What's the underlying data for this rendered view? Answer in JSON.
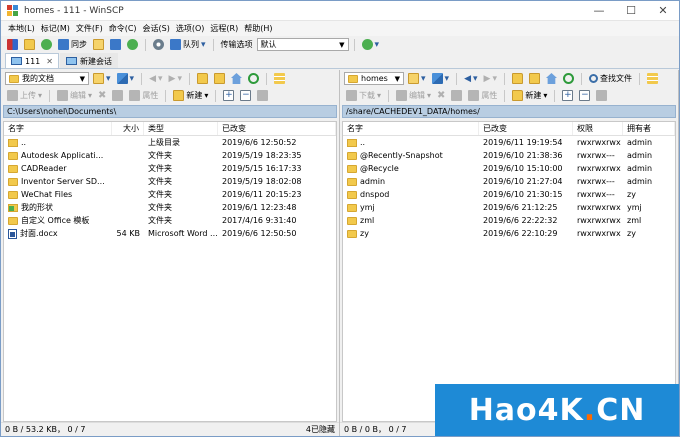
{
  "window": {
    "title": "homes - 111 - WinSCP"
  },
  "menu": [
    "本地(L)",
    "标记(M)",
    "文件(F)",
    "命令(C)",
    "会话(S)",
    "选项(O)",
    "远程(R)",
    "帮助(H)"
  ],
  "toolbar": {
    "sync_label": "同步",
    "queue_label": "队列",
    "transfer_options_label": "传输选项",
    "transfer_preset": "默认"
  },
  "tabs": [
    {
      "label": "111"
    },
    {
      "label": "新建会话"
    }
  ],
  "left": {
    "location": "我的文档",
    "upload_label": "上传",
    "edit_label": "编辑",
    "properties_label": "属性",
    "new_label": "新建",
    "path": "C:\\Users\\nohel\\Documents\\",
    "columns": [
      "名字",
      "大小",
      "类型",
      "已改变"
    ],
    "files": [
      {
        "icon": "up",
        "name": "..",
        "size": "",
        "type": "上级目录",
        "changed": "2019/6/6  12:50:52"
      },
      {
        "icon": "folder",
        "name": "Autodesk Applicati...",
        "size": "",
        "type": "文件夹",
        "changed": "2019/5/19  18:23:35"
      },
      {
        "icon": "folder",
        "name": "CADReader",
        "size": "",
        "type": "文件夹",
        "changed": "2019/5/15  16:17:33"
      },
      {
        "icon": "folder",
        "name": "Inventor Server SD...",
        "size": "",
        "type": "文件夹",
        "changed": "2019/5/19  18:02:08"
      },
      {
        "icon": "folder",
        "name": "WeChat Files",
        "size": "",
        "type": "文件夹",
        "changed": "2019/6/11  20:15:23"
      },
      {
        "icon": "special",
        "name": "我的形状",
        "size": "",
        "type": "文件夹",
        "changed": "2019/6/1  12:23:48"
      },
      {
        "icon": "folder",
        "name": "自定义 Office 模板",
        "size": "",
        "type": "文件夹",
        "changed": "2017/4/16  9:31:40"
      },
      {
        "icon": "doc",
        "name": "封面.docx",
        "size": "54 KB",
        "type": "Microsoft Word ...",
        "changed": "2019/6/6  12:50:50"
      }
    ],
    "status": "0 B / 53.2 KB，  0 / 7",
    "hidden": "4已隐藏"
  },
  "right": {
    "location": "homes",
    "download_label": "下载",
    "edit_label": "编辑",
    "properties_label": "属性",
    "new_label": "新建",
    "find_label": "查找文件",
    "path": "/share/CACHEDEV1_DATA/homes/",
    "columns": [
      "名字",
      "已改变",
      "权限",
      "拥有者"
    ],
    "files": [
      {
        "icon": "up",
        "name": "..",
        "changed": "2019/6/11  19:19:54",
        "rights": "rwxrwxrwx",
        "owner": "admin"
      },
      {
        "icon": "folder",
        "name": "@Recently-Snapshot",
        "changed": "2019/6/10  21:38:36",
        "rights": "rwxrwx---",
        "owner": "admin"
      },
      {
        "icon": "folder",
        "name": "@Recycle",
        "changed": "2019/6/10  15:10:00",
        "rights": "rwxrwxrwx",
        "owner": "admin"
      },
      {
        "icon": "folder",
        "name": "admin",
        "changed": "2019/6/10  21:27:04",
        "rights": "rwxrwx---",
        "owner": "admin"
      },
      {
        "icon": "folder",
        "name": "dnspod",
        "changed": "2019/6/10  21:30:15",
        "rights": "rwxrwx---",
        "owner": "zy"
      },
      {
        "icon": "folder",
        "name": "ymj",
        "changed": "2019/6/6  21:12:25",
        "rights": "rwxrwxrwx",
        "owner": "ymj"
      },
      {
        "icon": "folder",
        "name": "zml",
        "changed": "2019/6/6  22:22:32",
        "rights": "rwxrwxrwx",
        "owner": "zml"
      },
      {
        "icon": "folder",
        "name": "zy",
        "changed": "2019/6/6  22:10:29",
        "rights": "rwxrwxrwx",
        "owner": "zy"
      }
    ],
    "status": "0 B / 0 B，  0 / 7"
  },
  "watermark": {
    "main": "Hao4K",
    "dot": ".",
    "suffix": "CN"
  }
}
